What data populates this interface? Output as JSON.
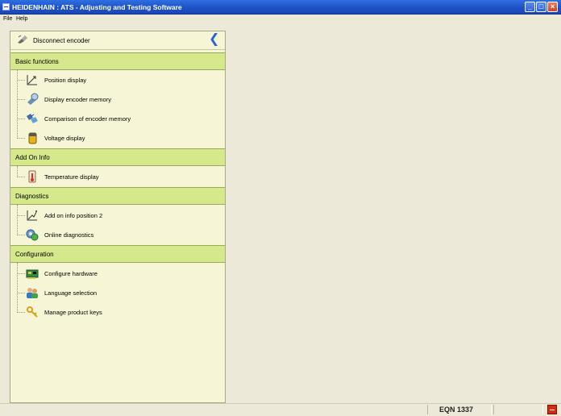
{
  "window": {
    "title": "HEIDENHAIN : ATS - Adjusting and Testing Software"
  },
  "menu": {
    "file": "File",
    "help": "Help"
  },
  "sidebar": {
    "disconnect_label": "Disconnect encoder",
    "sections": [
      {
        "label": "Basic functions",
        "items": [
          {
            "label": "Position display",
            "icon": "position-display-icon"
          },
          {
            "label": "Display encoder memory",
            "icon": "encoder-memory-icon"
          },
          {
            "label": "Comparison of encoder memory",
            "icon": "memory-comparison-icon"
          },
          {
            "label": "Voltage display",
            "icon": "voltage-icon"
          }
        ]
      },
      {
        "label": "Add On Info",
        "items": [
          {
            "label": "Temperature display",
            "icon": "thermometer-icon"
          }
        ]
      },
      {
        "label": "Diagnostics",
        "items": [
          {
            "label": "Add on info position 2",
            "icon": "position-display-icon"
          },
          {
            "label": "Online diagnostics",
            "icon": "online-diagnostics-icon"
          }
        ]
      },
      {
        "label": "Configuration",
        "items": [
          {
            "label": "Configure hardware",
            "icon": "hardware-card-icon"
          },
          {
            "label": "Language selection",
            "icon": "language-people-icon"
          },
          {
            "label": "Manage product keys",
            "icon": "keys-icon"
          }
        ]
      }
    ]
  },
  "status": {
    "encoder": "EQN 1337"
  },
  "colors": {
    "section_bg": "#d6e88c",
    "sidebar_bg": "#f6f6d6",
    "titlebar": "#1e52c7",
    "collapse_arrow": "#2a63d6"
  }
}
